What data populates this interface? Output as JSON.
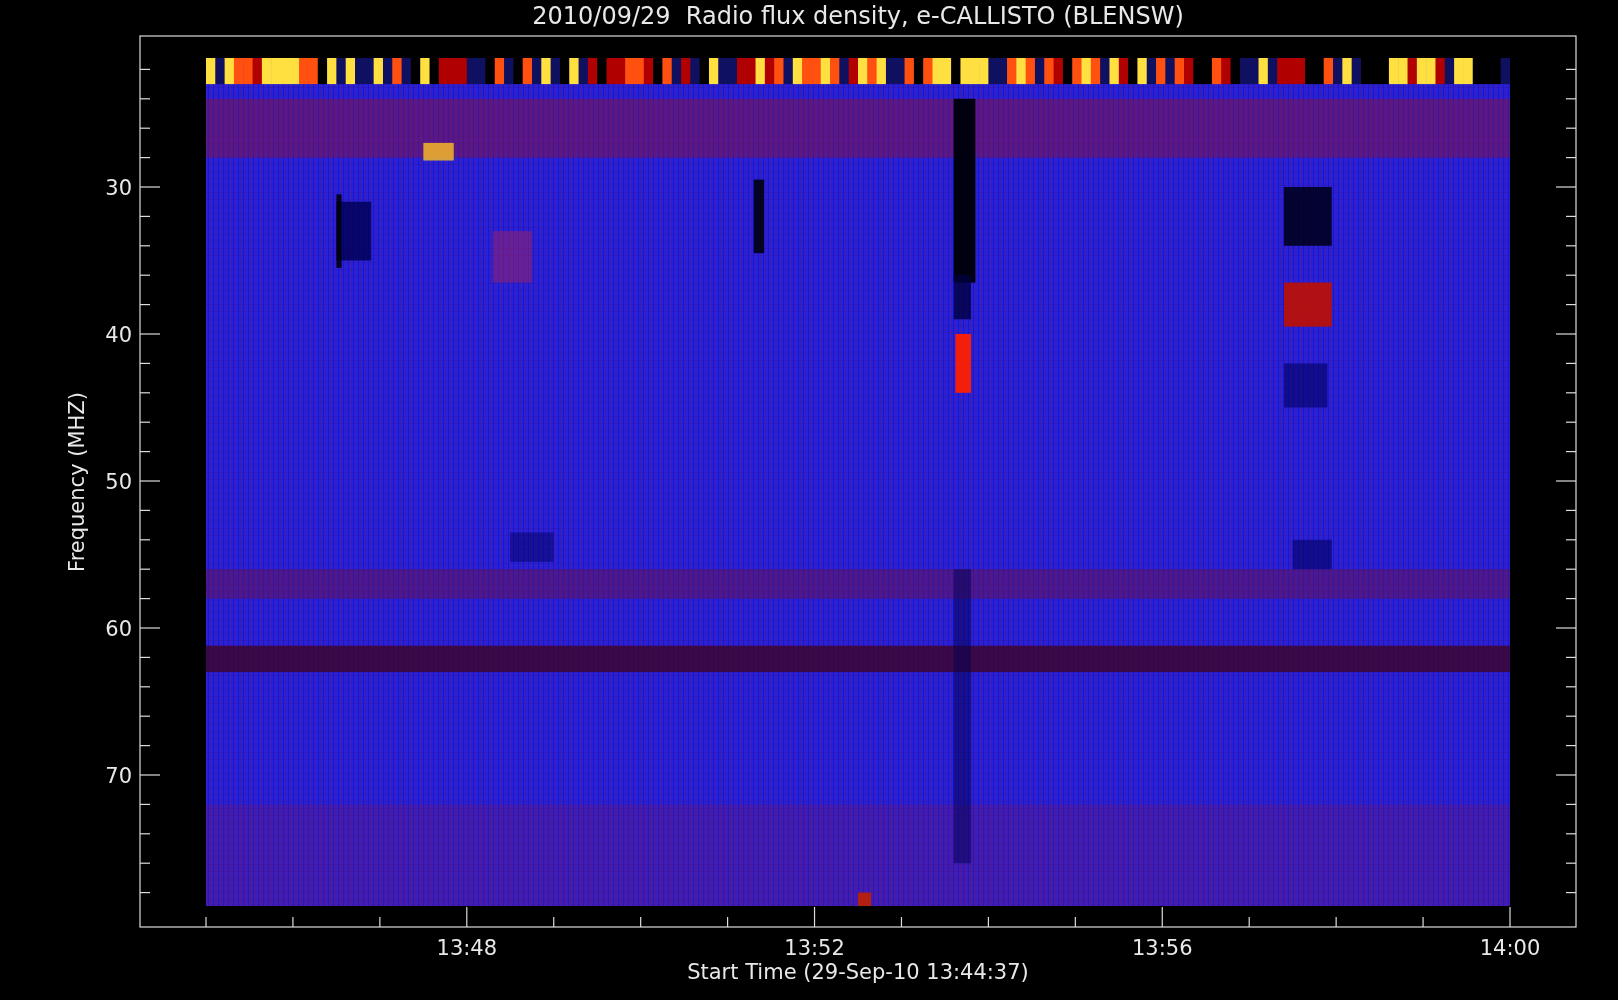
{
  "title": "2010/09/29  Radio flux density, e-CALLISTO (BLENSW)",
  "x_axis": {
    "label": "Start Time (29-Sep-10 13:44:37)",
    "ticks": [
      "13:48",
      "13:52",
      "13:56",
      "14:00"
    ]
  },
  "y_axis": {
    "label": "Frequency (MHZ)",
    "ticks": [
      "30",
      "40",
      "50",
      "60",
      "70"
    ]
  }
}
